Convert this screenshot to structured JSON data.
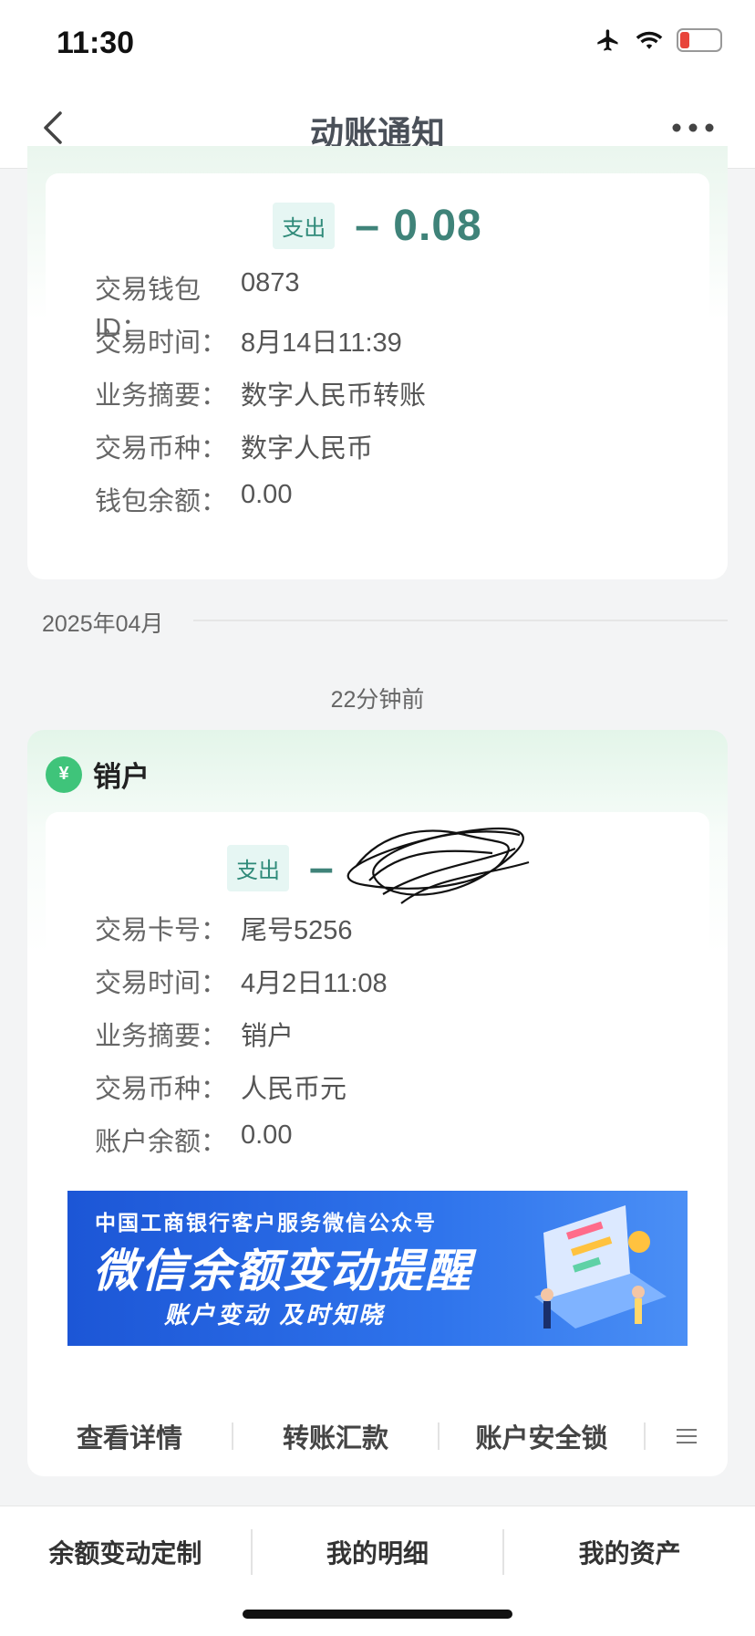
{
  "status_bar": {
    "time": "11:30",
    "battery": "12"
  },
  "nav": {
    "title": "动账通知"
  },
  "notice1": {
    "tag": "支出",
    "amount": "– 0.08",
    "rows": [
      {
        "label": "交易钱包ID：",
        "value": "0873"
      },
      {
        "label": "交易时间：",
        "value": "8月14日11:39"
      },
      {
        "label": "业务摘要：",
        "value": "数字人民币转账"
      },
      {
        "label": "交易币种：",
        "value": "数字人民币"
      },
      {
        "label": "钱包余额：",
        "value": "0.00"
      }
    ]
  },
  "month_divider": "2025年04月",
  "time_ago": "22分钟前",
  "notice2": {
    "logo_glyph": "¥",
    "title": "销户",
    "tag": "支出",
    "amount": "–",
    "rows": [
      {
        "label": "交易卡号：",
        "value": "尾号5256"
      },
      {
        "label": "交易时间：",
        "value": "4月2日11:08"
      },
      {
        "label": "业务摘要：",
        "value": "销户"
      },
      {
        "label": "交易币种：",
        "value": "人民币元"
      },
      {
        "label": "账户余额：",
        "value": "0.00"
      }
    ],
    "banner": {
      "line1": "中国工商银行客户服务微信公众号",
      "line2": "微信余额变动提醒",
      "line3": "账户变动 及时知晓"
    },
    "actions": [
      "查看详情",
      "转账汇款",
      "账户安全锁"
    ]
  },
  "bottom_bar": [
    "余额变动定制",
    "我的明细",
    "我的资产"
  ],
  "colors": {
    "accent": "#3f8379",
    "tag_bg": "#e6f6f3",
    "banner_blue": "#2f74ec"
  }
}
